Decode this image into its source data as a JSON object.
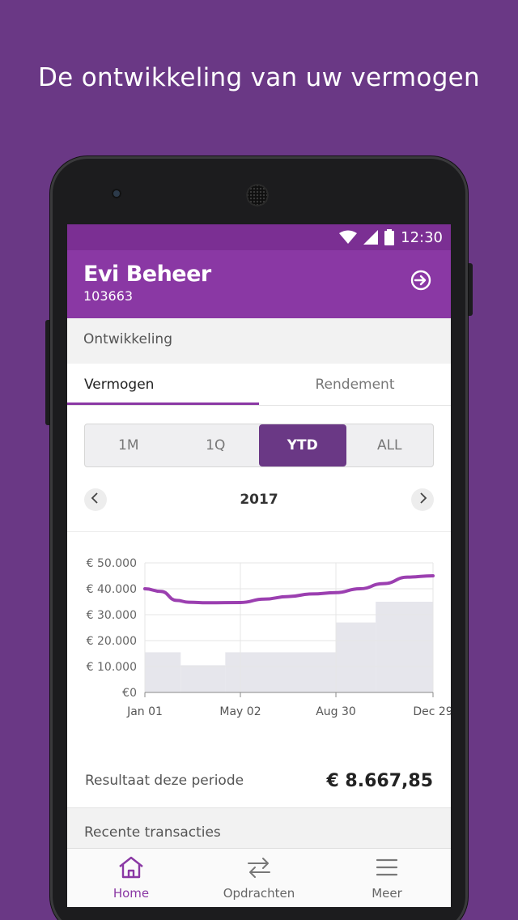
{
  "headline": "De ontwikkeling van uw vermogen",
  "status_bar": {
    "time": "12:30"
  },
  "header": {
    "title": "Evi Beheer",
    "account_number": "103663",
    "logout_icon": "logout-icon"
  },
  "section": {
    "title": "Ontwikkeling"
  },
  "tabs": [
    {
      "label": "Vermogen",
      "active": true
    },
    {
      "label": "Rendement",
      "active": false
    }
  ],
  "period_selector": [
    {
      "label": "1M",
      "active": false
    },
    {
      "label": "1Q",
      "active": false
    },
    {
      "label": "YTD",
      "active": true
    },
    {
      "label": "ALL",
      "active": false
    }
  ],
  "year_nav": {
    "year": "2017",
    "prev_icon": "chevron-left-icon",
    "next_icon": "chevron-right-icon"
  },
  "chart_data": {
    "type": "line",
    "y_tick_labels": [
      "€ 50.000",
      "€ 40.000",
      "€ 30.000",
      "€ 20.000",
      "€ 10.000",
      "€0"
    ],
    "ylim": [
      0,
      50000
    ],
    "x_tick_labels": [
      "Jan 01",
      "May 02",
      "Aug 30",
      "Dec 29"
    ],
    "line_series": {
      "x_days": [
        0,
        20,
        40,
        55,
        80,
        120,
        150,
        180,
        210,
        240,
        270,
        300,
        330,
        362
      ],
      "values": [
        40000,
        39000,
        35500,
        34800,
        34600,
        34700,
        36000,
        37000,
        38000,
        38500,
        40000,
        42000,
        44500,
        45000
      ],
      "color": "#9b3fb0"
    },
    "bars": [
      {
        "from_day": 0,
        "to_day": 45,
        "value": 15500
      },
      {
        "from_day": 45,
        "to_day": 101,
        "value": 10500
      },
      {
        "from_day": 101,
        "to_day": 240,
        "value": 15500
      },
      {
        "from_day": 240,
        "to_day": 290,
        "value": 27000
      },
      {
        "from_day": 290,
        "to_day": 362,
        "value": 35000
      }
    ],
    "grid": true,
    "bar_color": "#e6e6ec"
  },
  "result": {
    "label": "Resultaat deze periode",
    "value": "€ 8.667,85"
  },
  "recent": {
    "title": "Recente transacties"
  },
  "bottom_nav": [
    {
      "label": "Home",
      "icon": "home-icon",
      "active": true
    },
    {
      "label": "Opdrachten",
      "icon": "transfer-icon",
      "active": false
    },
    {
      "label": "Meer",
      "icon": "menu-icon",
      "active": false
    }
  ],
  "colors": {
    "background": "#6a3885",
    "accent": "#8a38a4",
    "status_bar": "#7b2f93"
  }
}
